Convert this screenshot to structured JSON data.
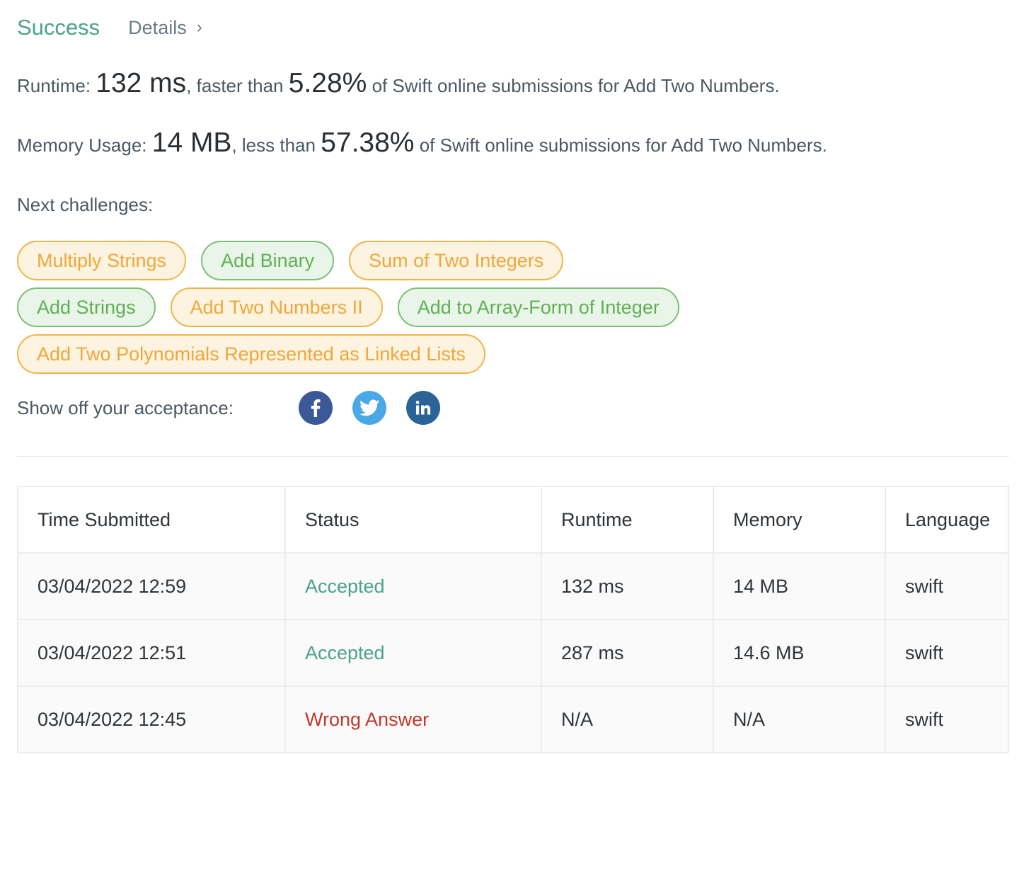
{
  "header": {
    "status": "Success",
    "details_label": "Details",
    "details_chevron": "›"
  },
  "runtime_line": {
    "label": "Runtime:",
    "value": "132 ms",
    "mid": ", faster than",
    "percent": "5.28%",
    "suffix": "of Swift online submissions for Add Two Numbers."
  },
  "memory_line": {
    "label": "Memory Usage:",
    "value": "14 MB",
    "mid": ", less than",
    "percent": "57.38%",
    "suffix": "of Swift online submissions for Add Two Numbers."
  },
  "next_challenges": {
    "label": "Next challenges:",
    "rows": [
      [
        {
          "label": "Multiply Strings",
          "difficulty": "medium"
        },
        {
          "label": "Add Binary",
          "difficulty": "easy"
        },
        {
          "label": "Sum of Two Integers",
          "difficulty": "medium"
        }
      ],
      [
        {
          "label": "Add Strings",
          "difficulty": "easy"
        },
        {
          "label": "Add Two Numbers II",
          "difficulty": "medium"
        },
        {
          "label": "Add to Array-Form of Integer",
          "difficulty": "easy"
        }
      ],
      [
        {
          "label": "Add Two Polynomials Represented as Linked Lists",
          "difficulty": "medium"
        }
      ]
    ]
  },
  "share": {
    "label": "Show off your acceptance:",
    "icons": [
      "facebook-icon",
      "twitter-icon",
      "linkedin-icon"
    ]
  },
  "table": {
    "headers": [
      "Time Submitted",
      "Status",
      "Runtime",
      "Memory",
      "Language"
    ],
    "rows": [
      {
        "time": "03/04/2022 12:59",
        "status": "Accepted",
        "runtime": "132 ms",
        "memory": "14 MB",
        "language": "swift"
      },
      {
        "time": "03/04/2022 12:51",
        "status": "Accepted",
        "runtime": "287 ms",
        "memory": "14.6 MB",
        "language": "swift"
      },
      {
        "time": "03/04/2022 12:45",
        "status": "Wrong Answer",
        "runtime": "N/A",
        "memory": "N/A",
        "language": "swift"
      }
    ]
  },
  "colors": {
    "success": "#4ba28c",
    "medium_tag": "#f0a73a",
    "easy_tag": "#5fb054",
    "wrong_answer": "#c0392b",
    "facebook": "#3b5998",
    "twitter": "#4aa8e8",
    "linkedin": "#2a6496"
  }
}
